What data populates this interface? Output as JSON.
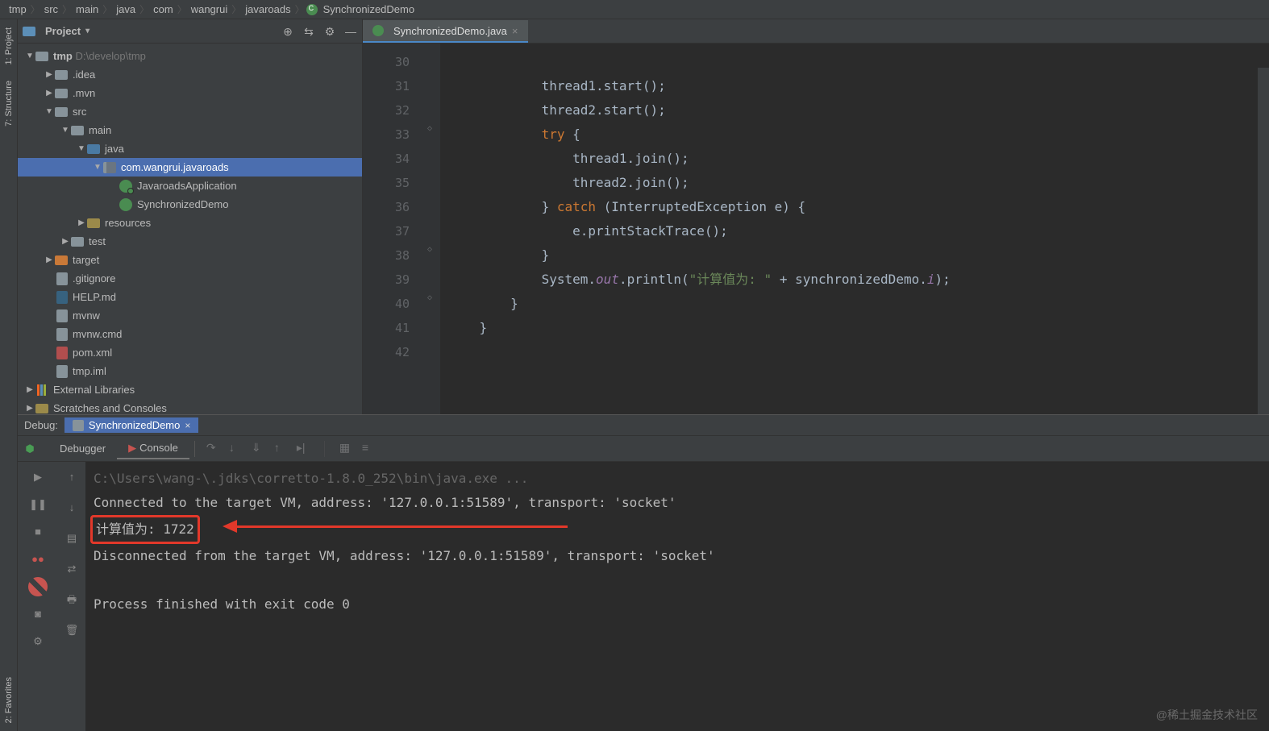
{
  "breadcrumb": [
    "tmp",
    "src",
    "main",
    "java",
    "com",
    "wangrui",
    "javaroads",
    "SynchronizedDemo"
  ],
  "left_rail": {
    "project": "1: Project",
    "structure": "7: Structure",
    "favorites": "2: Favorites"
  },
  "project_panel": {
    "title": "Project",
    "icons": {
      "target": "⊕",
      "collapse": "⇆",
      "settings": "⚙",
      "hide": "—"
    },
    "tree": {
      "root": {
        "name": "tmp",
        "path": "D:\\develop\\tmp"
      },
      "idea": ".idea",
      "mvn": ".mvn",
      "src": "src",
      "main": "main",
      "java": "java",
      "pkg": "com.wangrui.javaroads",
      "app": "JavaroadsApplication",
      "sync": "SynchronizedDemo",
      "resources": "resources",
      "test": "test",
      "target": "target",
      "gitignore": ".gitignore",
      "help": "HELP.md",
      "mvnw": "mvnw",
      "mvnwcmd": "mvnw.cmd",
      "pom": "pom.xml",
      "iml": "tmp.iml",
      "extlib": "External Libraries",
      "scratches": "Scratches and Consoles"
    }
  },
  "editor": {
    "tab_name": "SynchronizedDemo.java",
    "line_start": 30,
    "lines": [
      "",
      "            thread1.start();",
      "            thread2.start();",
      "            try {",
      "                thread1.join();",
      "                thread2.join();",
      "            } catch (InterruptedException e) {",
      "                e.printStackTrace();",
      "            }",
      "            System.out.println(\"计算值为: \" + synchronizedDemo.i);",
      "        }",
      "    }",
      ""
    ]
  },
  "debug": {
    "label": "Debug:",
    "tab": "SynchronizedDemo",
    "subtabs": {
      "debugger": "Debugger",
      "console": "Console"
    },
    "console_lines": {
      "l1": "C:\\Users\\wang-\\.jdks\\corretto-1.8.0_252\\bin\\java.exe ...",
      "l2": "Connected to the target VM, address: '127.0.0.1:51589', transport: 'socket'",
      "l3": "计算值为: 1722",
      "l4": "Disconnected from the target VM, address: '127.0.0.1:51589', transport: 'socket'",
      "l5": "Process finished with exit code 0"
    }
  },
  "watermark": "@稀土掘金技术社区"
}
